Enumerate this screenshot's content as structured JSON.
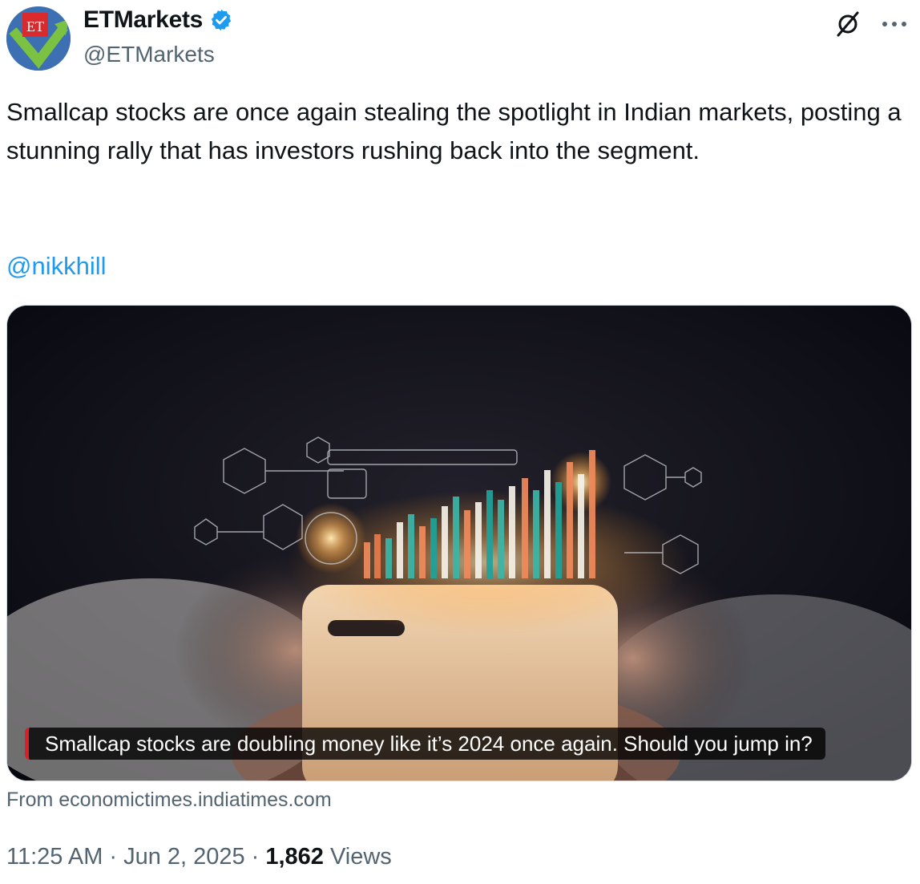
{
  "author": {
    "display_name": "ETMarkets",
    "handle": "@ETMarkets",
    "avatar_text": "ET",
    "verified_badge_icon": "verified-badge-icon",
    "verified_color": "#1d9bf0"
  },
  "actions": {
    "grok_icon": "grok-icon",
    "more_icon": "more-options-icon"
  },
  "tweet": {
    "text": "Smallcap stocks are once again stealing the spotlight in Indian markets, posting a stunning rally that has investors rushing back into the segment.",
    "mention": "@nikkhill",
    "mention_color": "#1d9bf0"
  },
  "card": {
    "headline": "Smallcap stocks are doubling money like it’s 2024 once again. Should you jump in?",
    "source": "From economictimes.indiatimes.com"
  },
  "meta": {
    "time": "11:25 AM",
    "separator": "·",
    "date": "Jun 2, 2025",
    "views_count": "1,862",
    "views_label": "Views"
  }
}
